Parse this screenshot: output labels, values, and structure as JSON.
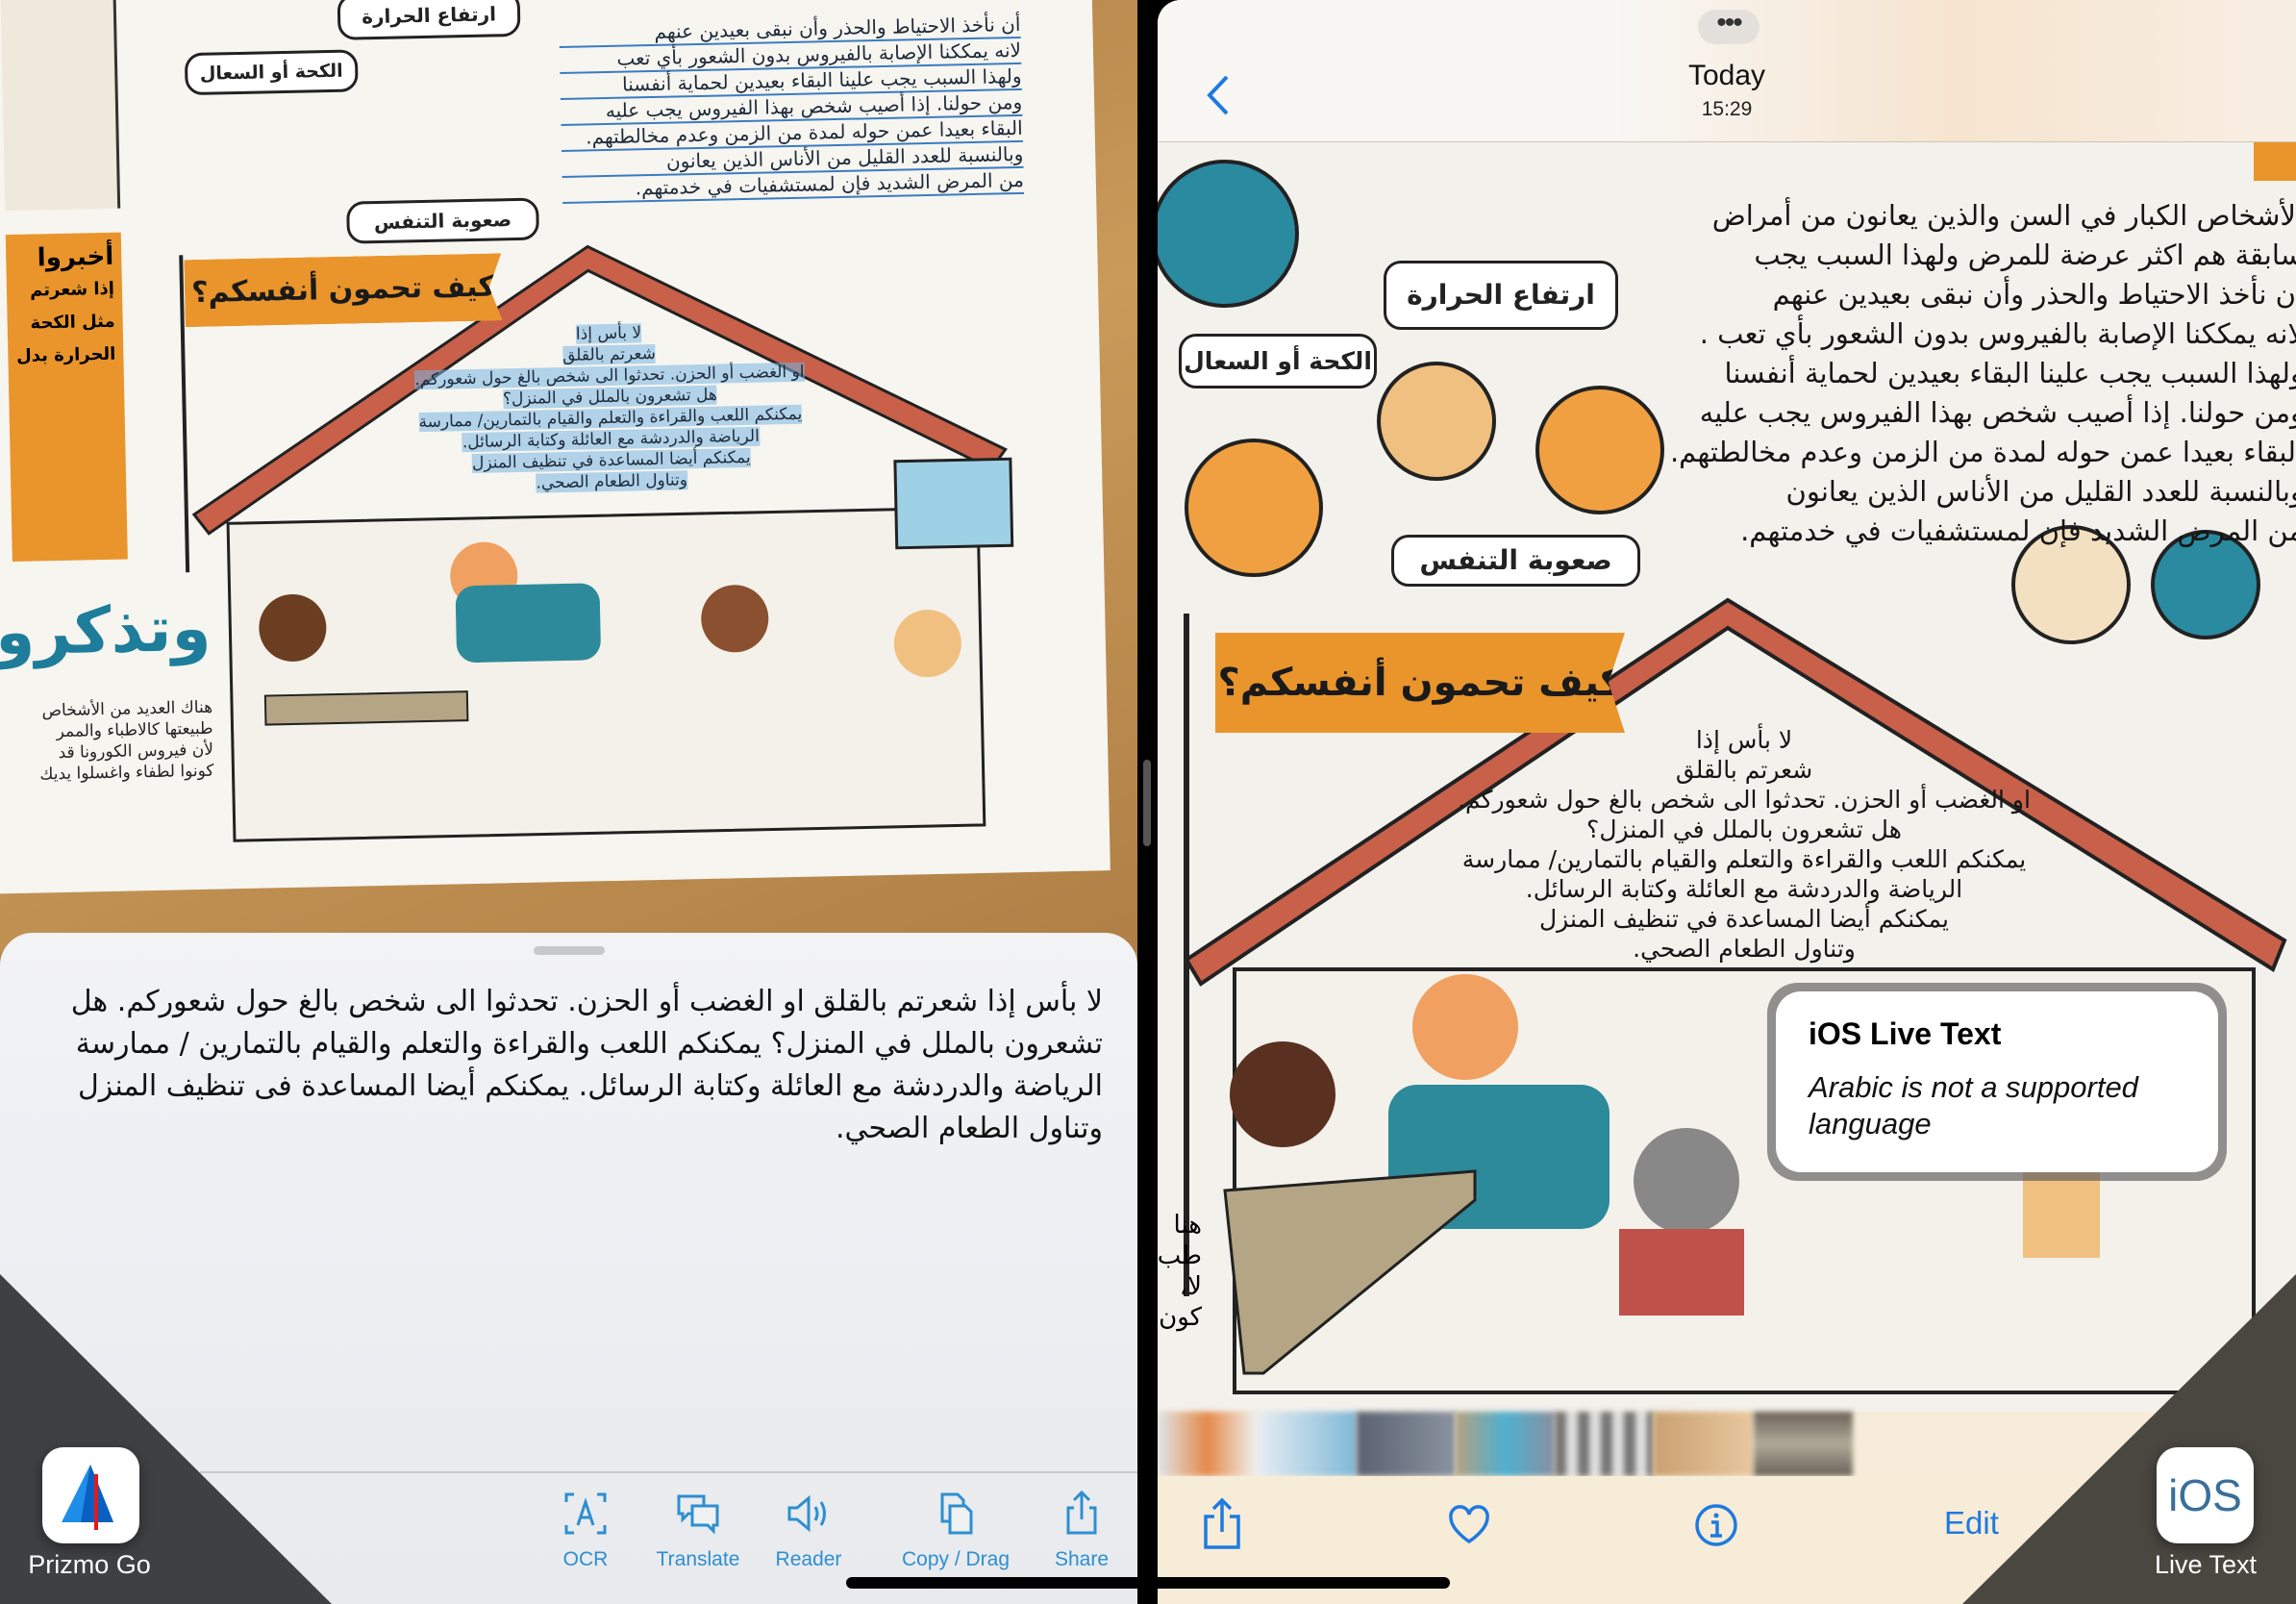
{
  "left_app": {
    "photo": {
      "bubbles": [
        "ارتفاع الحرارة",
        "الكحة أو السعال",
        "صعوبة التنفس"
      ],
      "banner": "كيف تحمون أنفسكم؟",
      "side_box": [
        "أخبروا",
        "إذا شعرتم",
        "مثل الكحة",
        "الحرارة بدل"
      ],
      "remember_title": "وتذكروا",
      "remember_lines": [
        "هناك العديد من الأشخاص",
        "طبيعتها كالاطباء والممر",
        "لأن فيروس الكورونا قد",
        "كونوا لطفاء واغسلوا يديك"
      ],
      "top_lines": [
        "أن نأخذ الاحتياط والحذر وأن نبقى بعيدين عنهم",
        "لانه يمككنا الإصابة بالفيروس بدون الشعور بأي تعب",
        "ولهذا السبب يجب علينا البقاء بعيدين لحماية أنفسنا",
        "ومن حولنا. إذا أصيب شخص بهذا الفيروس يجب عليه",
        "البقاء بعيدا عمن حوله لمدة من الزمن وعدم مخالطتهم.",
        "وبالنسبة للعدد القليل من الأناس الذين يعانون",
        "من المرض الشديد فإن لمستشفيات في خدمتهم."
      ]
    },
    "recognized_text": "لا بأس إذا شعرتم بالقلق او الغضب أو الحزن. تحدثوا الى شخص بالغ حول شعوركم. هل تشعرون بالملل في المنزل؟ يمكنكم اللعب والقراءة والتعلم والقيام بالتمارين / ممارسة الرياضة والدردشة مع العائلة وكتابة الرسائل. يمكنكم أيضا المساعدة فى تنظيف المنزل وتناول الطعام الصحي.",
    "toolbar": [
      {
        "label": "OCR",
        "icon": "ocr-icon"
      },
      {
        "label": "Translate",
        "icon": "translate-icon"
      },
      {
        "label": "Reader",
        "icon": "speaker-icon"
      },
      {
        "label": "Copy / Drag",
        "icon": "copy-icon"
      },
      {
        "label": "Share",
        "icon": "share-icon"
      }
    ],
    "badge_label": "Prizmo Go",
    "accent": "#2d8fd0"
  },
  "right_app": {
    "header": {
      "title": "Today",
      "subtitle": "15:29"
    },
    "photo": {
      "paragraph": [
        "الأشخاص الكبار في السن والذين يعانون من أمراض",
        "سابقة هم اكثر عرضة للمرض ولهذا السبب يجب",
        "أن نأخذ الاحتياط والحذر وأن نبقى بعيدين عنهم",
        "لانه يمككنا الإصابة بالفيروس بدون الشعور بأي تعب .",
        "ولهذا السبب يجب علينا البقاء بعيدين لحماية أنفسنا",
        "ومن حولنا. إذا أصيب شخص بهذا الفيروس يجب عليه",
        "البقاء بعيدا عمن حوله لمدة من الزمن وعدم مخالطتهم.",
        "وبالنسبة للعدد القليل من الأناس الذين يعانون",
        "من المرض الشديد فإن لمستشفيات في خدمتهم."
      ],
      "center_text": [
        "لا بأس إذا",
        "شعرتم بالقلق",
        "او الغضب أو الحزن. تحدثوا الى شخص بالغ حول شعوركم.",
        "هل تشعرون بالملل في المنزل؟",
        "يمكنكم اللعب والقراءة والتعلم والقيام بالتمارين/ ممارسة",
        "الرياضة والدردشة مع العائلة وكتابة الرسائل.",
        "يمكنكم أيضا المساعدة في تنظيف المنزل",
        "وتناول الطعام الصحي."
      ],
      "side_fragments": [
        "هنا",
        "طب",
        "لا،",
        "كون"
      ]
    },
    "popup": {
      "title": "iOS Live Text",
      "message": "Arabic is not a supported language"
    },
    "toolbar": {
      "edit_label": "Edit"
    },
    "badge_label": "Live Text",
    "badge_icon_text": "iOS",
    "accent": "#1e7ae0"
  }
}
